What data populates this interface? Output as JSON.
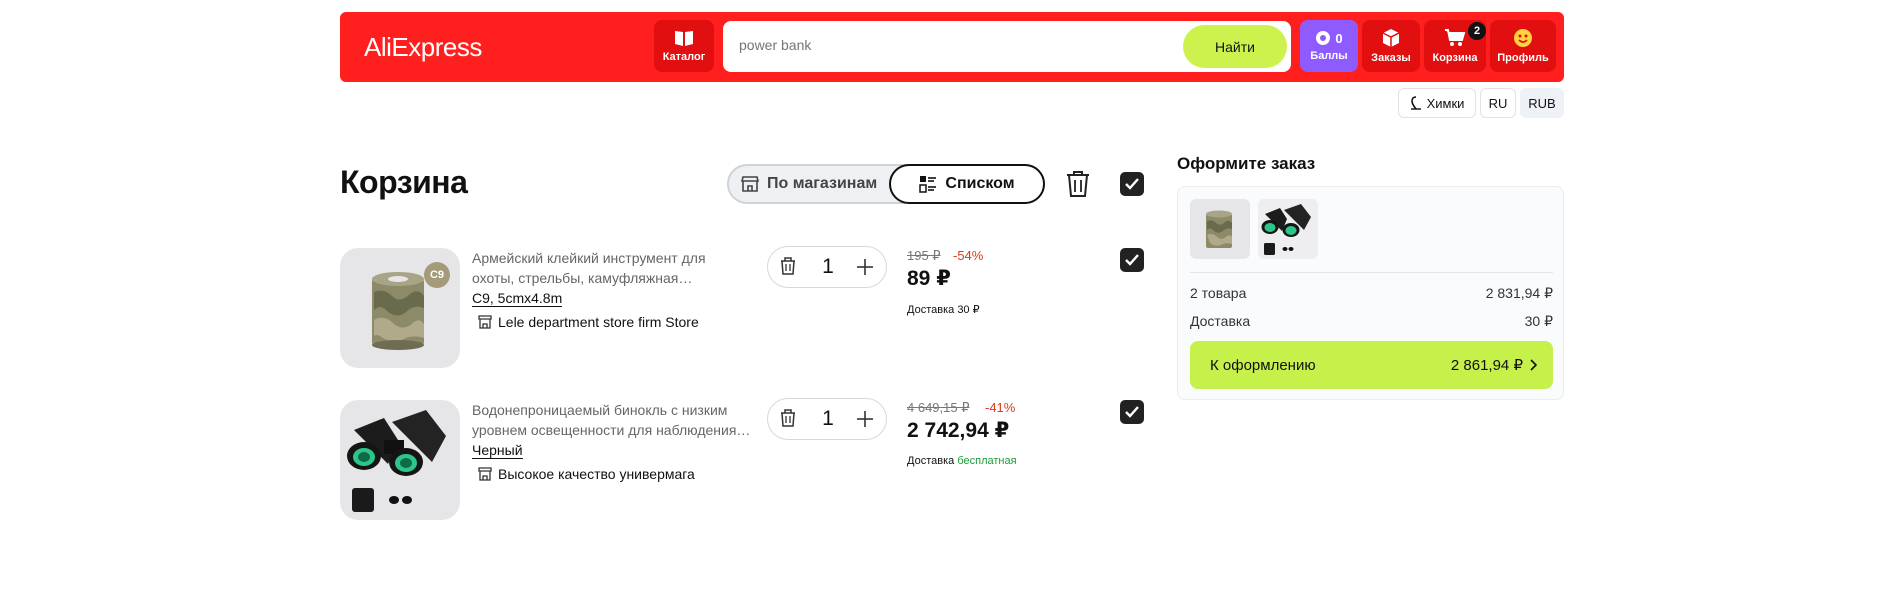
{
  "header": {
    "logo": "AliExpress",
    "catalog_label": "Каталог",
    "search": {
      "value": "",
      "placeholder": "power bank",
      "button_label": "Найти"
    },
    "points": {
      "count": "0",
      "label": "Баллы"
    },
    "orders_label": "Заказы",
    "cart": {
      "label": "Корзина",
      "badge": "2"
    },
    "profile_label": "Профиль"
  },
  "subheader": {
    "city": "Химки",
    "language": "RU",
    "currency": "RUB"
  },
  "page": {
    "title": "Корзина",
    "view_toggle": {
      "by_stores": "По магазинам",
      "list": "Списком",
      "active": "list"
    }
  },
  "items": [
    {
      "title_line1": "Армейский клейкий инструмент для",
      "title_line2": "охоты, стрельбы, камуфляжная…",
      "variant": "C9, 5cmx4.8m",
      "store": "Lele department store firm Store",
      "quantity": "1",
      "old_price": "195 ₽",
      "discount": "-54%",
      "price": "89 ₽",
      "delivery_label": "Доставка",
      "delivery_value": "30 ₽",
      "thumb_badge": "C9",
      "checked": true
    },
    {
      "title_line1": "Водонепроницаемый бинокль с низким",
      "title_line2": "уровнем освещенности для наблюдения…",
      "variant": "Черный",
      "store": "Высокое качество универмага",
      "quantity": "1",
      "old_price": "4 649,15 ₽",
      "discount": "-41%",
      "price": "2 742,94 ₽",
      "delivery_label": "Доставка",
      "delivery_value": "бесплатная",
      "checked": true
    }
  ],
  "summary": {
    "title": "Оформите заказ",
    "goods_label": "2 товара",
    "goods_value": "2 831,94 ₽",
    "delivery_label": "Доставка",
    "delivery_value": "30 ₽",
    "checkout_label": "К оформлению",
    "checkout_total": "2 861,94 ₽"
  },
  "colors": {
    "header_bg": "#ff1f1f",
    "accent_lime": "#c6f04a",
    "points_purple": "#8e5bff",
    "discount_red": "#d83a1a",
    "free_green": "#1f9d37"
  }
}
